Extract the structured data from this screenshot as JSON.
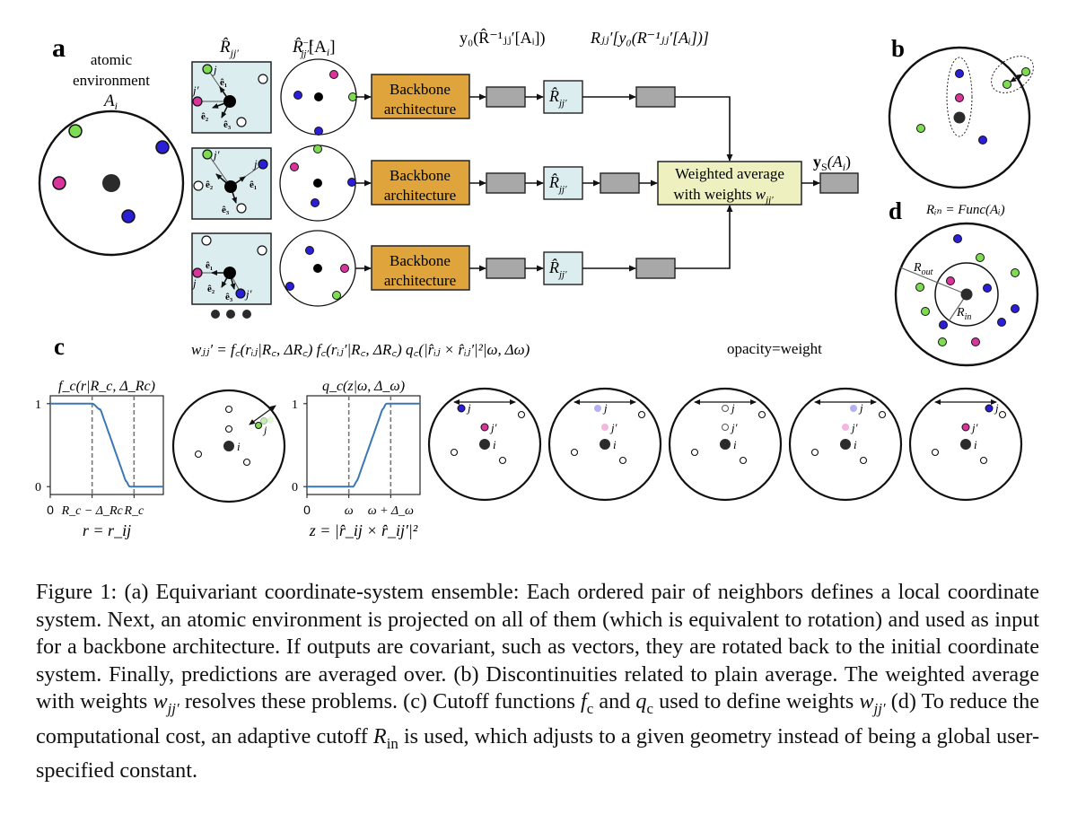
{
  "figure": {
    "panel_labels": {
      "a": "a",
      "b": "b",
      "c": "c",
      "d": "d"
    },
    "panel_a": {
      "env_label_line1": "atomic",
      "env_label_line2": "environment",
      "env_symbol": "A",
      "env_symbol_sub": "i",
      "col_rotation_label": "R̂",
      "col_rotation_sub": "jj′",
      "col_inverse_label": "R̂",
      "col_inverse_sup": "−1",
      "col_inverse_sub": "jj′",
      "col_inverse_arg": "[A",
      "col_inverse_arg_sub": "i",
      "col_inverse_arg_end": "]",
      "col_output_label": "y₀(R̂⁻¹ⱼⱼ′[Aᵢ])",
      "col_rotated_output_label": "Rⱼⱼ′[y₀(R⁻¹ⱼⱼ′[Aᵢ])]",
      "backbone_line1": "Backbone",
      "backbone_line2": "architecture",
      "rotation_box_label": "R̂",
      "rotation_box_sub": "jj′",
      "weighted_line1": "Weighted average",
      "weighted_line2": "with weights",
      "weighted_symbol": "w",
      "weighted_symbol_sub": "jj′",
      "final_output_label": "y",
      "final_output_sub": "S",
      "final_output_arg": "(A",
      "final_output_arg_sub": "i",
      "final_output_arg_end": ")",
      "axis_labels": [
        "ê₁",
        "ê₂",
        "ê₃"
      ],
      "neighbor_labels": {
        "j": "j",
        "jp": "j′"
      },
      "ellipsis": "•••"
    },
    "panel_d": {
      "formula": "Rᵢₙ = Func(Aᵢ)",
      "r_out": "R",
      "r_out_sub": "out",
      "r_in": "R",
      "r_in_sub": "in"
    },
    "panel_c": {
      "formula": "wⱼⱼ′ = f꜀(rᵢⱼ|R꜀, ΔR꜀) f꜀(rᵢⱼ′|R꜀, ΔR꜀) q꜀(|r̂ᵢⱼ × r̂ᵢⱼ′|²|ω, Δω)",
      "opacity_note": "opacity=weight",
      "center_label": "i",
      "j_label": "j",
      "jp_label": "j′"
    },
    "colors": {
      "green": "#7ddc4f",
      "magenta": "#d9349b",
      "blue": "#2a1fd6",
      "center": "#2b2b2b",
      "backbone": "#e0a43c",
      "weighted": "#eef0c0",
      "rotation_box": "#dcedf0",
      "gray_box": "#a8a8a8",
      "curve": "#3a78b5"
    }
  },
  "chart_data": [
    {
      "type": "line",
      "title": "f_c(r|R_c, Δ_Rc)",
      "xlabel": "r = r_ij",
      "ylabel": "",
      "x_tick_labels": [
        "0",
        "R_c − Δ_Rc",
        "R_c"
      ],
      "y_tick_labels": [
        "0",
        "1"
      ],
      "ylim": [
        0,
        1
      ],
      "xlim": [
        0,
        1.35
      ],
      "vlines": [
        0.5,
        1.0
      ],
      "series": [
        {
          "name": "f_c",
          "x": [
            0,
            0.5,
            0.6,
            0.75,
            0.9,
            0.95,
            1.35
          ],
          "y": [
            1,
            1,
            0.93,
            0.5,
            0.07,
            0,
            0
          ]
        }
      ],
      "grid": false
    },
    {
      "type": "line",
      "title": "q_c(z|ω, Δ_ω)",
      "xlabel": "z = |r̂_ij × r̂_ij′|²",
      "ylabel": "",
      "x_tick_labels": [
        "0",
        "ω",
        "ω + Δ_ω"
      ],
      "y_tick_labels": [
        "0",
        "1"
      ],
      "ylim": [
        0,
        1
      ],
      "xlim": [
        0,
        1.35
      ],
      "vlines": [
        0.5,
        1.0
      ],
      "series": [
        {
          "name": "q_c",
          "x": [
            0,
            0.55,
            0.6,
            0.75,
            0.9,
            0.95,
            1.35
          ],
          "y": [
            0,
            0,
            0.07,
            0.5,
            0.93,
            1,
            1
          ]
        }
      ],
      "grid": false
    }
  ],
  "caption": {
    "label": "Figure 1:",
    "segments": [
      {
        "t": "text",
        "v": "Figure 1: (a) Equivariant coordinate-system ensemble: Each ordered pair of neighbors defines a local coordinate system. Next, an atomic environment is projected on all of them (which is equivalent to rotation) and used as input for a backbone architecture. If outputs are covariant, such as vectors, they are rotated back to the initial coordinate system. Finally, predictions are averaged over. (b) Discontinuities related to plain average. The weighted average with weights "
      },
      {
        "t": "math",
        "v": "w",
        "sub": "jj′"
      },
      {
        "t": "text",
        "v": " resolves these problems. (c) Cutoff functions "
      },
      {
        "t": "math",
        "v": "f",
        "sub": "c",
        "subupright": true
      },
      {
        "t": "text",
        "v": " and "
      },
      {
        "t": "math",
        "v": "q",
        "sub": "c",
        "subupright": true
      },
      {
        "t": "text",
        "v": " used to define weights "
      },
      {
        "t": "math",
        "v": "w",
        "sub": "jj′"
      },
      {
        "t": "text",
        "v": " (d) To reduce the computational cost, an adaptive cutoff "
      },
      {
        "t": "math",
        "v": "R",
        "sub": "in",
        "subupright": true
      },
      {
        "t": "text",
        "v": " is used, which adjusts to a given geometry instead of being a global user-specified constant."
      }
    ]
  }
}
